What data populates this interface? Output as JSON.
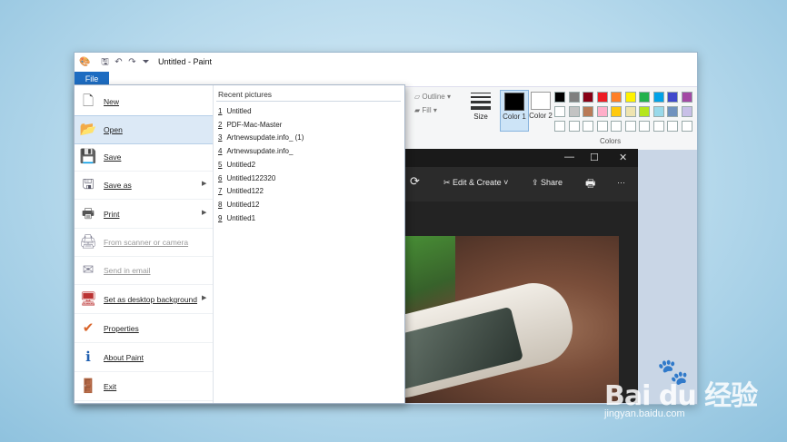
{
  "window": {
    "title": "Untitled - Paint"
  },
  "file_tab": "File",
  "ribbon": {
    "outline": "Outline",
    "fill": "Fill",
    "size": "Size",
    "color1": "Color 1",
    "color2": "Color 2",
    "colors_group": "Colors",
    "palette": [
      "#000000",
      "#7f7f7f",
      "#880015",
      "#ed1c24",
      "#ff7f27",
      "#fff200",
      "#22b14c",
      "#00a2e8",
      "#3f48cc",
      "#a349a4",
      "#ffffff",
      "#c3c3c3",
      "#b97a57",
      "#ffaec9",
      "#ffc90e",
      "#efe4b0",
      "#b5e61d",
      "#99d9ea",
      "#7092be",
      "#c8bfe7",
      "#ffffff",
      "#ffffff",
      "#ffffff",
      "#ffffff",
      "#ffffff",
      "#ffffff",
      "#ffffff",
      "#ffffff",
      "#ffffff",
      "#ffffff"
    ]
  },
  "file_menu": {
    "items": [
      {
        "label": "New",
        "icon": "new-file-icon",
        "glyph": "🗋"
      },
      {
        "label": "Open",
        "icon": "open-folder-icon",
        "glyph": "📂"
      },
      {
        "label": "Save",
        "icon": "save-disk-icon",
        "glyph": "💾"
      },
      {
        "label": "Save as",
        "icon": "save-as-icon",
        "glyph": "🖫"
      },
      {
        "label": "Print",
        "icon": "printer-icon",
        "glyph": "🖶"
      },
      {
        "label": "From scanner or camera",
        "icon": "scanner-icon",
        "glyph": "🖨"
      },
      {
        "label": "Send in email",
        "icon": "email-icon",
        "glyph": "✉"
      },
      {
        "label": "Set as desktop background",
        "icon": "desktop-background-icon",
        "glyph": "🖥"
      },
      {
        "label": "Properties",
        "icon": "checkmark-icon",
        "glyph": "✔"
      },
      {
        "label": "About Paint",
        "icon": "info-icon",
        "glyph": "ℹ"
      },
      {
        "label": "Exit",
        "icon": "exit-icon",
        "glyph": "🚪"
      }
    ],
    "recent_header": "Recent pictures",
    "recent": [
      {
        "num": "1",
        "name": "Untitled"
      },
      {
        "num": "2",
        "name": "PDF-Mac-Master"
      },
      {
        "num": "3",
        "name": "Artnewsupdate.info_ (1)"
      },
      {
        "num": "4",
        "name": "Artnewsupdate.info_"
      },
      {
        "num": "5",
        "name": "Untitled2"
      },
      {
        "num": "6",
        "name": "Untitled122320"
      },
      {
        "num": "7",
        "name": "Untitled122"
      },
      {
        "num": "8",
        "name": "Untitled12"
      },
      {
        "num": "9",
        "name": "Untitled1"
      }
    ]
  },
  "photos": {
    "edit_create": "Edit & Create",
    "share": "Share"
  },
  "watermark": {
    "logo": "Bai du 经验",
    "sub": "jingyan.baidu.com"
  }
}
